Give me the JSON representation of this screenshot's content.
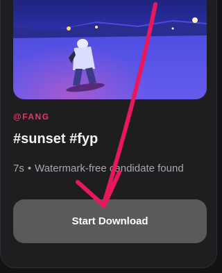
{
  "video": {
    "author": "@FANG",
    "title": "#sunset #fyp",
    "duration": "7s",
    "separator": "•",
    "status": "Watermark-free candidate found"
  },
  "actions": {
    "download_label": "Start Download"
  },
  "colors": {
    "accent": "#e23a62",
    "annotation_arrow": "#e8195a",
    "button_bg": "#5a5a5d",
    "card_bg": "#1e1e21"
  }
}
